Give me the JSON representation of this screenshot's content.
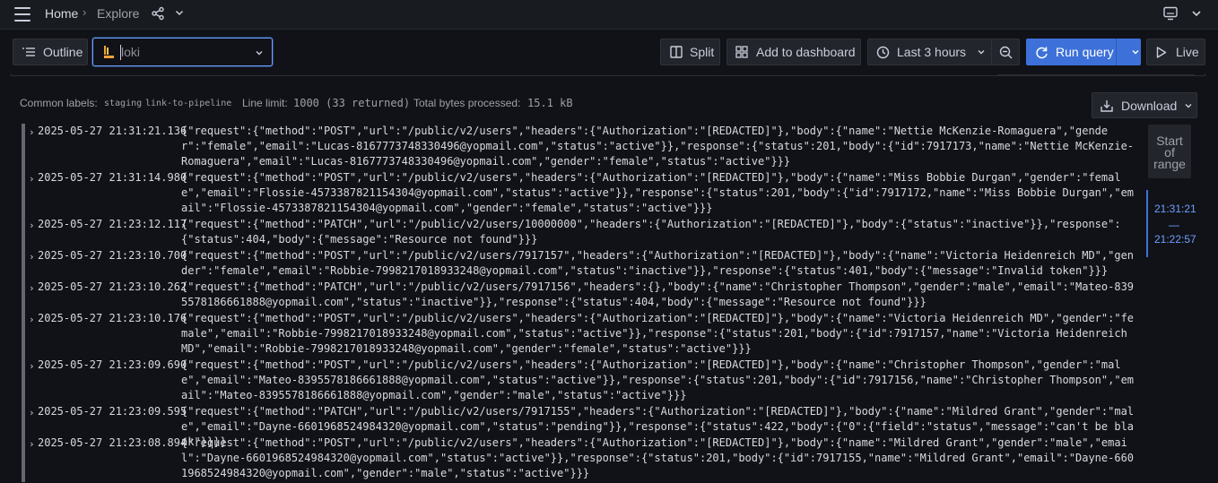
{
  "topbar": {
    "breadcrumb": [
      "Home",
      "Explore"
    ],
    "separator": "›",
    "icons": [
      "menu-icon",
      "share-icon",
      "chevron-down-icon",
      "monitor-icon",
      "chevron-down-icon"
    ]
  },
  "toolbar": {
    "outline_label": "Outline",
    "datasource_value": "loki",
    "split_label": "Split",
    "add_to_dashboard_label": "Add to dashboard",
    "time_range_label": "Last 3 hours",
    "run_query_label": "Run query",
    "live_label": "Live"
  },
  "meta": {
    "common_labels_label": "Common labels:",
    "common_labels": [
      "staging",
      "link-to-pipeline"
    ],
    "line_limit_label": "Line limit:",
    "line_limit_value": "1000 (33 returned)",
    "bytes_label": "Total bytes processed:",
    "bytes_value": "15.1 kB",
    "download_label": "Download"
  },
  "logs": [
    {
      "time": "2025-05-27 21:31:21.136",
      "line": "{\"request\":{\"method\":\"POST\",\"url\":\"/public/v2/users\",\"headers\":{\"Authorization\":\"[REDACTED]\"},\"body\":{\"name\":\"Nettie McKenzie-Romaguera\",\"gender\":\"female\",\"email\":\"Lucas-8167773748330496@yopmail.com\",\"status\":\"active\"}},\"response\":{\"status\":201,\"body\":{\"id\":7917173,\"name\":\"Nettie McKenzie-Romaguera\",\"email\":\"Lucas-8167773748330496@yopmail.com\",\"gender\":\"female\",\"status\":\"active\"}}}"
    },
    {
      "time": "2025-05-27 21:31:14.980",
      "line": "{\"request\":{\"method\":\"POST\",\"url\":\"/public/v2/users\",\"headers\":{\"Authorization\":\"[REDACTED]\"},\"body\":{\"name\":\"Miss Bobbie Durgan\",\"gender\":\"female\",\"email\":\"Flossie-4573387821154304@yopmail.com\",\"status\":\"active\"}},\"response\":{\"status\":201,\"body\":{\"id\":7917172,\"name\":\"Miss Bobbie Durgan\",\"email\":\"Flossie-4573387821154304@yopmail.com\",\"gender\":\"female\",\"status\":\"active\"}}}"
    },
    {
      "time": "2025-05-27 21:23:12.117",
      "line": "{\"request\":{\"method\":\"PATCH\",\"url\":\"/public/v2/users/10000000\",\"headers\":{\"Authorization\":\"[REDACTED]\"},\"body\":{\"status\":\"inactive\"}},\"response\":{\"status\":404,\"body\":{\"message\":\"Resource not found\"}}}"
    },
    {
      "time": "2025-05-27 21:23:10.700",
      "line": "{\"request\":{\"method\":\"POST\",\"url\":\"/public/v2/users/7917157\",\"headers\":{\"Authorization\":\"[REDACTED]\"},\"body\":{\"name\":\"Victoria Heidenreich MD\",\"gender\":\"female\",\"email\":\"Robbie-7998217018933248@yopmail.com\",\"status\":\"inactive\"}},\"response\":{\"status\":401,\"body\":{\"message\":\"Invalid token\"}}}"
    },
    {
      "time": "2025-05-27 21:23:10.262",
      "line": "{\"request\":{\"method\":\"PATCH\",\"url\":\"/public/v2/users/7917156\",\"headers\":{},\"body\":{\"name\":\"Christopher Thompson\",\"gender\":\"male\",\"email\":\"Mateo-8395578186661888@yopmail.com\",\"status\":\"inactive\"}},\"response\":{\"status\":404,\"body\":{\"message\":\"Resource not found\"}}}"
    },
    {
      "time": "2025-05-27 21:23:10.176",
      "line": "{\"request\":{\"method\":\"POST\",\"url\":\"/public/v2/users\",\"headers\":{\"Authorization\":\"[REDACTED]\"},\"body\":{\"name\":\"Victoria Heidenreich MD\",\"gender\":\"female\",\"email\":\"Robbie-7998217018933248@yopmail.com\",\"status\":\"active\"}},\"response\":{\"status\":201,\"body\":{\"id\":7917157,\"name\":\"Victoria Heidenreich MD\",\"email\":\"Robbie-7998217018933248@yopmail.com\",\"gender\":\"female\",\"status\":\"active\"}}}"
    },
    {
      "time": "2025-05-27 21:23:09.690",
      "line": "{\"request\":{\"method\":\"POST\",\"url\":\"/public/v2/users\",\"headers\":{\"Authorization\":\"[REDACTED]\"},\"body\":{\"name\":\"Christopher Thompson\",\"gender\":\"male\",\"email\":\"Mateo-8395578186661888@yopmail.com\",\"status\":\"active\"}},\"response\":{\"status\":201,\"body\":{\"id\":7917156,\"name\":\"Christopher Thompson\",\"email\":\"Mateo-8395578186661888@yopmail.com\",\"gender\":\"male\",\"status\":\"active\"}}}"
    },
    {
      "time": "2025-05-27 21:23:09.595",
      "line": "{\"request\":{\"method\":\"PATCH\",\"url\":\"/public/v2/users/7917155\",\"headers\":{\"Authorization\":\"[REDACTED]\"},\"body\":{\"name\":\"Mildred Grant\",\"gender\":\"male\",\"email\":\"Dayne-6601968524984320@yopmail.com\",\"status\":\"pending\"}},\"response\":{\"status\":422,\"body\":{\"0\":{\"field\":\"status\",\"message\":\"can't be blank\"}}}}"
    },
    {
      "time": "2025-05-27 21:23:08.894",
      "line": "{\"request\":{\"method\":\"POST\",\"url\":\"/public/v2/users\",\"headers\":{\"Authorization\":\"[REDACTED]\"},\"body\":{\"name\":\"Mildred Grant\",\"gender\":\"male\",\"email\":\"Dayne-6601968524984320@yopmail.com\",\"status\":\"active\"}},\"response\":{\"status\":201,\"body\":{\"id\":7917155,\"name\":\"Mildred Grant\",\"email\":\"Dayne-6601968524984320@yopmail.com\",\"gender\":\"male\",\"status\":\"active\"}}}"
    }
  ],
  "range": {
    "start_label": [
      "Start",
      "of",
      "range"
    ],
    "from": "21:31:21",
    "dash": "—",
    "to": "21:22:57"
  }
}
